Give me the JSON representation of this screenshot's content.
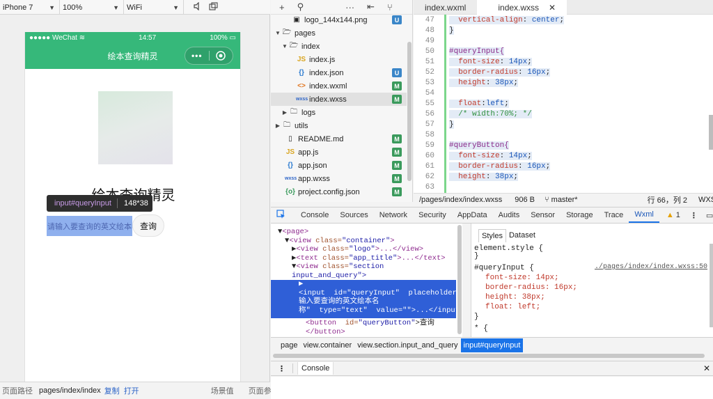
{
  "simulator": {
    "device": "iPhone 7",
    "zoom": "100%",
    "network": "WiFi",
    "status_bar": {
      "carrier": "●●●●● WeChat",
      "time": "14:57",
      "battery": "100%"
    },
    "nav_title": "绘本查询精灵",
    "app_title": "绘本查询精灵",
    "input_placeholder": "请输入要查询的英文绘本名",
    "query_button": "查询",
    "tooltip": {
      "selector": "input#queryInput",
      "size": "148*38"
    },
    "footer": {
      "path_label": "页面路径",
      "path_value": "pages/index/index",
      "copy": "复制",
      "open": "打开",
      "scene": "场景值",
      "params": "页面参数"
    }
  },
  "file_tree": {
    "items": [
      {
        "name": "logo_144x144.png",
        "badge": "U",
        "icon": "image-icon"
      },
      {
        "name": "pages",
        "badge": "",
        "icon": "folder-open-icon"
      },
      {
        "name": "index",
        "badge": "",
        "icon": "folder-open-icon"
      },
      {
        "name": "index.js",
        "badge": "",
        "icon": "js-file-icon"
      },
      {
        "name": "index.json",
        "badge": "U",
        "icon": "json-file-icon"
      },
      {
        "name": "index.wxml",
        "badge": "M",
        "icon": "wxml-file-icon"
      },
      {
        "name": "index.wxss",
        "badge": "M",
        "icon": "wxss-file-icon"
      },
      {
        "name": "logs",
        "badge": "",
        "icon": "folder-icon"
      },
      {
        "name": "utils",
        "badge": "",
        "icon": "folder-icon"
      },
      {
        "name": "README.md",
        "badge": "M",
        "icon": "file-icon"
      },
      {
        "name": "app.js",
        "badge": "M",
        "icon": "js-file-icon"
      },
      {
        "name": "app.json",
        "badge": "M",
        "icon": "json-file-icon"
      },
      {
        "name": "app.wxss",
        "badge": "M",
        "icon": "wxss-file-icon"
      },
      {
        "name": "project.config.json",
        "badge": "M",
        "icon": "json-file-icon"
      }
    ]
  },
  "editor": {
    "tabs": [
      "index.wxml",
      "index.wxss"
    ],
    "lines": [
      {
        "n": "47",
        "t": "  vertical-align: center;"
      },
      {
        "n": "48",
        "t": "}"
      },
      {
        "n": "49",
        "t": ""
      },
      {
        "n": "50",
        "t": "#queryInput{"
      },
      {
        "n": "51",
        "t": "  font-size: 14px;"
      },
      {
        "n": "52",
        "t": "  border-radius: 16px;"
      },
      {
        "n": "53",
        "t": "  height: 38px;"
      },
      {
        "n": "54",
        "t": ""
      },
      {
        "n": "55",
        "t": "  float:left;"
      },
      {
        "n": "56",
        "t": "  /* width:70%; */"
      },
      {
        "n": "57",
        "t": "}"
      },
      {
        "n": "58",
        "t": ""
      },
      {
        "n": "59",
        "t": "#queryButton{"
      },
      {
        "n": "60",
        "t": "  font-size: 14px;"
      },
      {
        "n": "61",
        "t": "  border-radius: 16px;"
      },
      {
        "n": "62",
        "t": "  height: 38px;"
      },
      {
        "n": "63",
        "t": ""
      }
    ],
    "status": {
      "path": "/pages/index/index.wxss",
      "size": "906 B",
      "branch": "master*",
      "position": "行 66，列 2",
      "lang": "WXSS"
    }
  },
  "devtools": {
    "tabs": [
      "Console",
      "Sources",
      "Network",
      "Security",
      "AppData",
      "Audits",
      "Sensor",
      "Storage",
      "Trace",
      "Wxml"
    ],
    "active_tab": "Wxml",
    "warnings": "1",
    "wxml": {
      "l1": "<page>",
      "l2_tag": "<view",
      "l2_attr": " class=",
      "l2_val": "\"container\"",
      "l2_end": ">",
      "l3_tag": "<view",
      "l3_attr": " class=",
      "l3_val": "\"logo\"",
      "l3_end": ">...</view>",
      "l4_tag": "<text",
      "l4_attr": " class=",
      "l4_val": "\"app_title\"",
      "l4_end": ">...</text>",
      "l5_tag": "<view",
      "l5_attr": " class=",
      "l5_val": "\"section",
      "l5b": "input_and_query\">",
      "sel_1": "▶",
      "sel_2": "<input  id=\"queryInput\"  placeholder=\"请",
      "sel_3": "输入要查询的英文绘本名",
      "sel_4": "称\"  type=\"text\"  value=\"\">...</input>",
      "l10_tag": "<button",
      "l10_attr": "  id=",
      "l10_val": "\"queryButton\"",
      "l10_end": ">查询",
      "l11": "</button>"
    },
    "styles": {
      "tabs": [
        "Styles",
        "Dataset"
      ],
      "element_style": "element.style {",
      "close1": "}",
      "rule_selector": "#queryInput {",
      "rule_source": "./pages/index/index.wxss:50",
      "decl1": "font-size: 14px;",
      "decl2": "border-radius: 16px;",
      "decl3": "height: 38px;",
      "decl4": "float: left;",
      "close2": "}",
      "universal": "* {"
    },
    "breadcrumb": [
      "page",
      "view.container",
      "view.section.input_and_query",
      "input#queryInput"
    ],
    "drawer_tab": "Console"
  }
}
